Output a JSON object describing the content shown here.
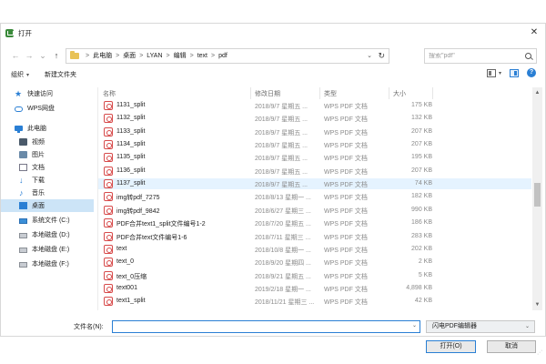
{
  "title": "打开",
  "address": {
    "crumbs": [
      "此电脑",
      "桌面",
      "LYAN",
      "编辑",
      "text",
      "pdf"
    ],
    "separator": ">"
  },
  "search": {
    "placeholder": "搜索\"pdf\""
  },
  "toolbar": {
    "organize": "组织",
    "new_folder": "新建文件夹"
  },
  "sidebar": {
    "items": [
      {
        "label": "快速访问",
        "icon": "star-icon"
      },
      {
        "label": "WPS网盘",
        "icon": "cloud-icon"
      },
      {
        "label": "此电脑",
        "icon": "computer-icon"
      },
      {
        "label": "视频",
        "icon": "video-icon"
      },
      {
        "label": "图片",
        "icon": "picture-icon"
      },
      {
        "label": "文档",
        "icon": "document-icon"
      },
      {
        "label": "下载",
        "icon": "download-icon"
      },
      {
        "label": "音乐",
        "icon": "music-icon"
      },
      {
        "label": "桌面",
        "icon": "desktop-icon",
        "selected": true
      },
      {
        "label": "系统文件 (C:)",
        "icon": "system-drive-icon"
      },
      {
        "label": "本地磁盘 (D:)",
        "icon": "drive-icon"
      },
      {
        "label": "本地磁盘 (E:)",
        "icon": "drive-icon"
      },
      {
        "label": "本地磁盘 (F:)",
        "icon": "drive-icon"
      }
    ]
  },
  "columns": {
    "name": "名称",
    "date": "修改日期",
    "type": "类型",
    "size": "大小"
  },
  "files": [
    {
      "name": "1131_split",
      "date": "2018/9/7 星期五 ...",
      "type": "WPS PDF 文档",
      "size": "175 KB"
    },
    {
      "name": "1132_split",
      "date": "2018/9/7 星期五 ...",
      "type": "WPS PDF 文档",
      "size": "132 KB"
    },
    {
      "name": "1133_split",
      "date": "2018/9/7 星期五 ...",
      "type": "WPS PDF 文档",
      "size": "207 KB"
    },
    {
      "name": "1134_split",
      "date": "2018/9/7 星期五 ...",
      "type": "WPS PDF 文档",
      "size": "207 KB"
    },
    {
      "name": "1135_split",
      "date": "2018/9/7 星期五 ...",
      "type": "WPS PDF 文档",
      "size": "195 KB"
    },
    {
      "name": "1136_split",
      "date": "2018/9/7 星期五 ...",
      "type": "WPS PDF 文档",
      "size": "207 KB"
    },
    {
      "name": "1137_split",
      "date": "2018/9/7 星期五 ...",
      "type": "WPS PDF 文档",
      "size": "74 KB",
      "hover": true
    },
    {
      "name": "img转pdf_7275",
      "date": "2018/8/13 星期一 ...",
      "type": "WPS PDF 文档",
      "size": "182 KB"
    },
    {
      "name": "img转pdf_9842",
      "date": "2018/6/27 星期三 ...",
      "type": "WPS PDF 文档",
      "size": "990 KB"
    },
    {
      "name": "PDF合并text1_split文件编号1-2",
      "date": "2018/7/20 星期五 ...",
      "type": "WPS PDF 文档",
      "size": "186 KB"
    },
    {
      "name": "PDF合并text文件编号1-6",
      "date": "2018/7/11 星期三 ...",
      "type": "WPS PDF 文档",
      "size": "283 KB"
    },
    {
      "name": "text",
      "date": "2018/10/8 星期一 ...",
      "type": "WPS PDF 文档",
      "size": "202 KB"
    },
    {
      "name": "text_0",
      "date": "2018/9/20 星期四 ...",
      "type": "WPS PDF 文档",
      "size": "2 KB"
    },
    {
      "name": "text_0压缩",
      "date": "2018/9/21 星期五 ...",
      "type": "WPS PDF 文档",
      "size": "5 KB"
    },
    {
      "name": "text001",
      "date": "2019/2/18 星期一 ...",
      "type": "WPS PDF 文档",
      "size": "4,898 KB"
    },
    {
      "name": "text1_split",
      "date": "2018/11/21 星期三 ...",
      "type": "WPS PDF 文档",
      "size": "42 KB"
    }
  ],
  "bottom": {
    "filename_label": "文件名(N):",
    "filename_value": "",
    "filetype": "闪电PDF编辑器",
    "open": "打开(O)",
    "cancel": "取消"
  }
}
